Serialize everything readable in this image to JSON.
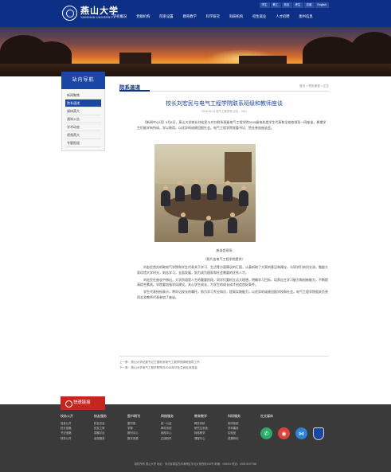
{
  "header": {
    "logo_cn": "燕山大学",
    "logo_en": "YANSHAN UNIVERSITY",
    "top_links": [
      "学生",
      "教工",
      "校友",
      "考生",
      "访客",
      "English"
    ],
    "nav": [
      "学校概况",
      "党群机构",
      "院系设置",
      "教育教学",
      "科学研究",
      "科研机构",
      "招生就业",
      "人才招聘",
      "图书信息"
    ]
  },
  "sidebar": {
    "title": "站内导航",
    "items": [
      {
        "label": "新闻聚焦",
        "active": false
      },
      {
        "label": "院系速递",
        "active": true
      },
      {
        "label": "媒体燕大",
        "active": false
      },
      {
        "label": "通知公告",
        "active": false
      },
      {
        "label": "学术动态",
        "active": false
      },
      {
        "label": "视频燕大",
        "active": false
      },
      {
        "label": "专题报道",
        "active": false
      }
    ]
  },
  "main": {
    "section_title": "院系速递",
    "breadcrumb": "首页 > 院系速递 > 正文",
    "article_title": "校长刘宏民与电气工程学院联系班级和教师座谈",
    "meta": "2016-05-13  电气工程学院  点击：3011",
    "lead": "【新闻中心讯】5月8日，燕山大学校长刘宏民与对口联系班级电气工程学院2015级电机类学生代表和全校各领导一同座谈，希望学生们能学有所成，学以致用，以优异的成绩回报社会。电气工程学院党委书记、院长参加座谈会。",
    "caption_1": "座谈会现场",
    "caption_2": "（照片由电气工程学院提供）",
    "paragraphs": [
      "刘宏民首先听取电气学院和学生代表关于学习、生活等方面情况的汇报，认真听取了大家的意见和建议，与同学们亲切交流，勉励大家珍惜大学时光，刻苦学习，全面发展，努力成为国家和社会需要的优秀人才。",
      "刘宏民在座谈中指出，大学阶段是人生的重要阶段，同学们要树立远大理想，明确学习目标，培养自主学习能力和创新能力，不断提高综合素质。学院要加强学风建设，关心学生成长，为学生的成长成才创造良好条件。",
      "学生代表纷纷表示，将牢记校长的嘱托，努力学习专业知识，提高实践能力，以优异的成绩回报学校和社会。电气工程学院相关负责同志及教师代表参加了座谈。"
    ],
    "prev": "上一条：燕山大学纪委书记王国栋到电气工程学院调研指导工作",
    "next": "下一条：燕山大学电气工程学院举办2016年毕业生就业双选会"
  },
  "quick_title": "快速链接",
  "footer": {
    "columns": [
      {
        "title": "校务公开",
        "items": [
          "信息公开",
          "校长信箱",
          "书记信箱",
          "财务公开"
        ]
      },
      {
        "title": "校友服务",
        "items": [
          "校友总会",
          "校友之家",
          "捐赠平台",
          "返校服务"
        ]
      },
      {
        "title": "图书期刊",
        "items": [
          "图书馆",
          "学报",
          "期刊中心",
          "数字资源"
        ]
      },
      {
        "title": "网络服务",
        "items": [
          "统一认证",
          "邮件系统",
          "网络中心",
          "正版软件"
        ]
      },
      {
        "title": "教育教学",
        "items": [
          "教务系统",
          "研究生系统",
          "网络教学",
          "课程中心"
        ]
      },
      {
        "title": "科研服务",
        "items": [
          "科研系统",
          "学科建设",
          "实验室",
          "成果转化"
        ]
      }
    ],
    "follow_title": "社交媒体",
    "copyright": "版权所有 燕山大学  地址：河北省秦皇岛市海港区河北大街西段438号  邮编：066004  电话：0335-8057068"
  },
  "colors": {
    "brand_blue": "#0d2f86",
    "accent_red": "#c7261f",
    "footer_bg": "#3a3a3a"
  }
}
